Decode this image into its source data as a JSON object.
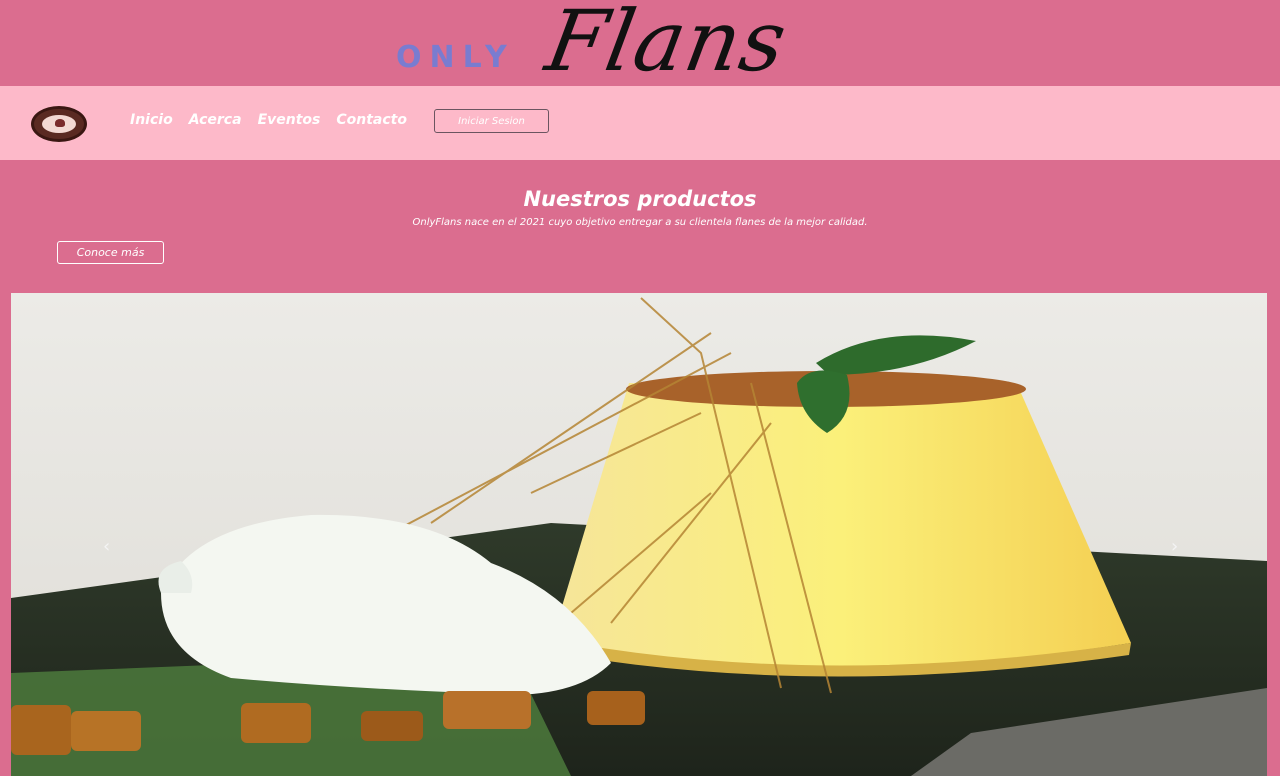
{
  "logo": {
    "prefix": "ONLY",
    "main": "Flans"
  },
  "nav": {
    "brand_icon": "flan-badge-icon",
    "links": [
      "Inicio",
      "Acerca",
      "Eventos",
      "Contacto"
    ],
    "login_label": "Iniciar Sesion"
  },
  "hero": {
    "title": "Nuestros productos",
    "subtitle": "OnlyFlans nace en el 2021 cuyo objetivo entregar a su clientela flanes de la mejor calidad.",
    "cta_label": "Conoce más"
  },
  "carousel": {
    "prev_icon": "chevron-left-icon",
    "next_icon": "chevron-right-icon",
    "prev_glyph": "‹",
    "next_glyph": "›"
  },
  "colors": {
    "header_bg": "#db6d8f",
    "nav_bg": "#fdb9c9",
    "logo_prefix": "#6f7ed8",
    "logo_main": "#111111"
  }
}
